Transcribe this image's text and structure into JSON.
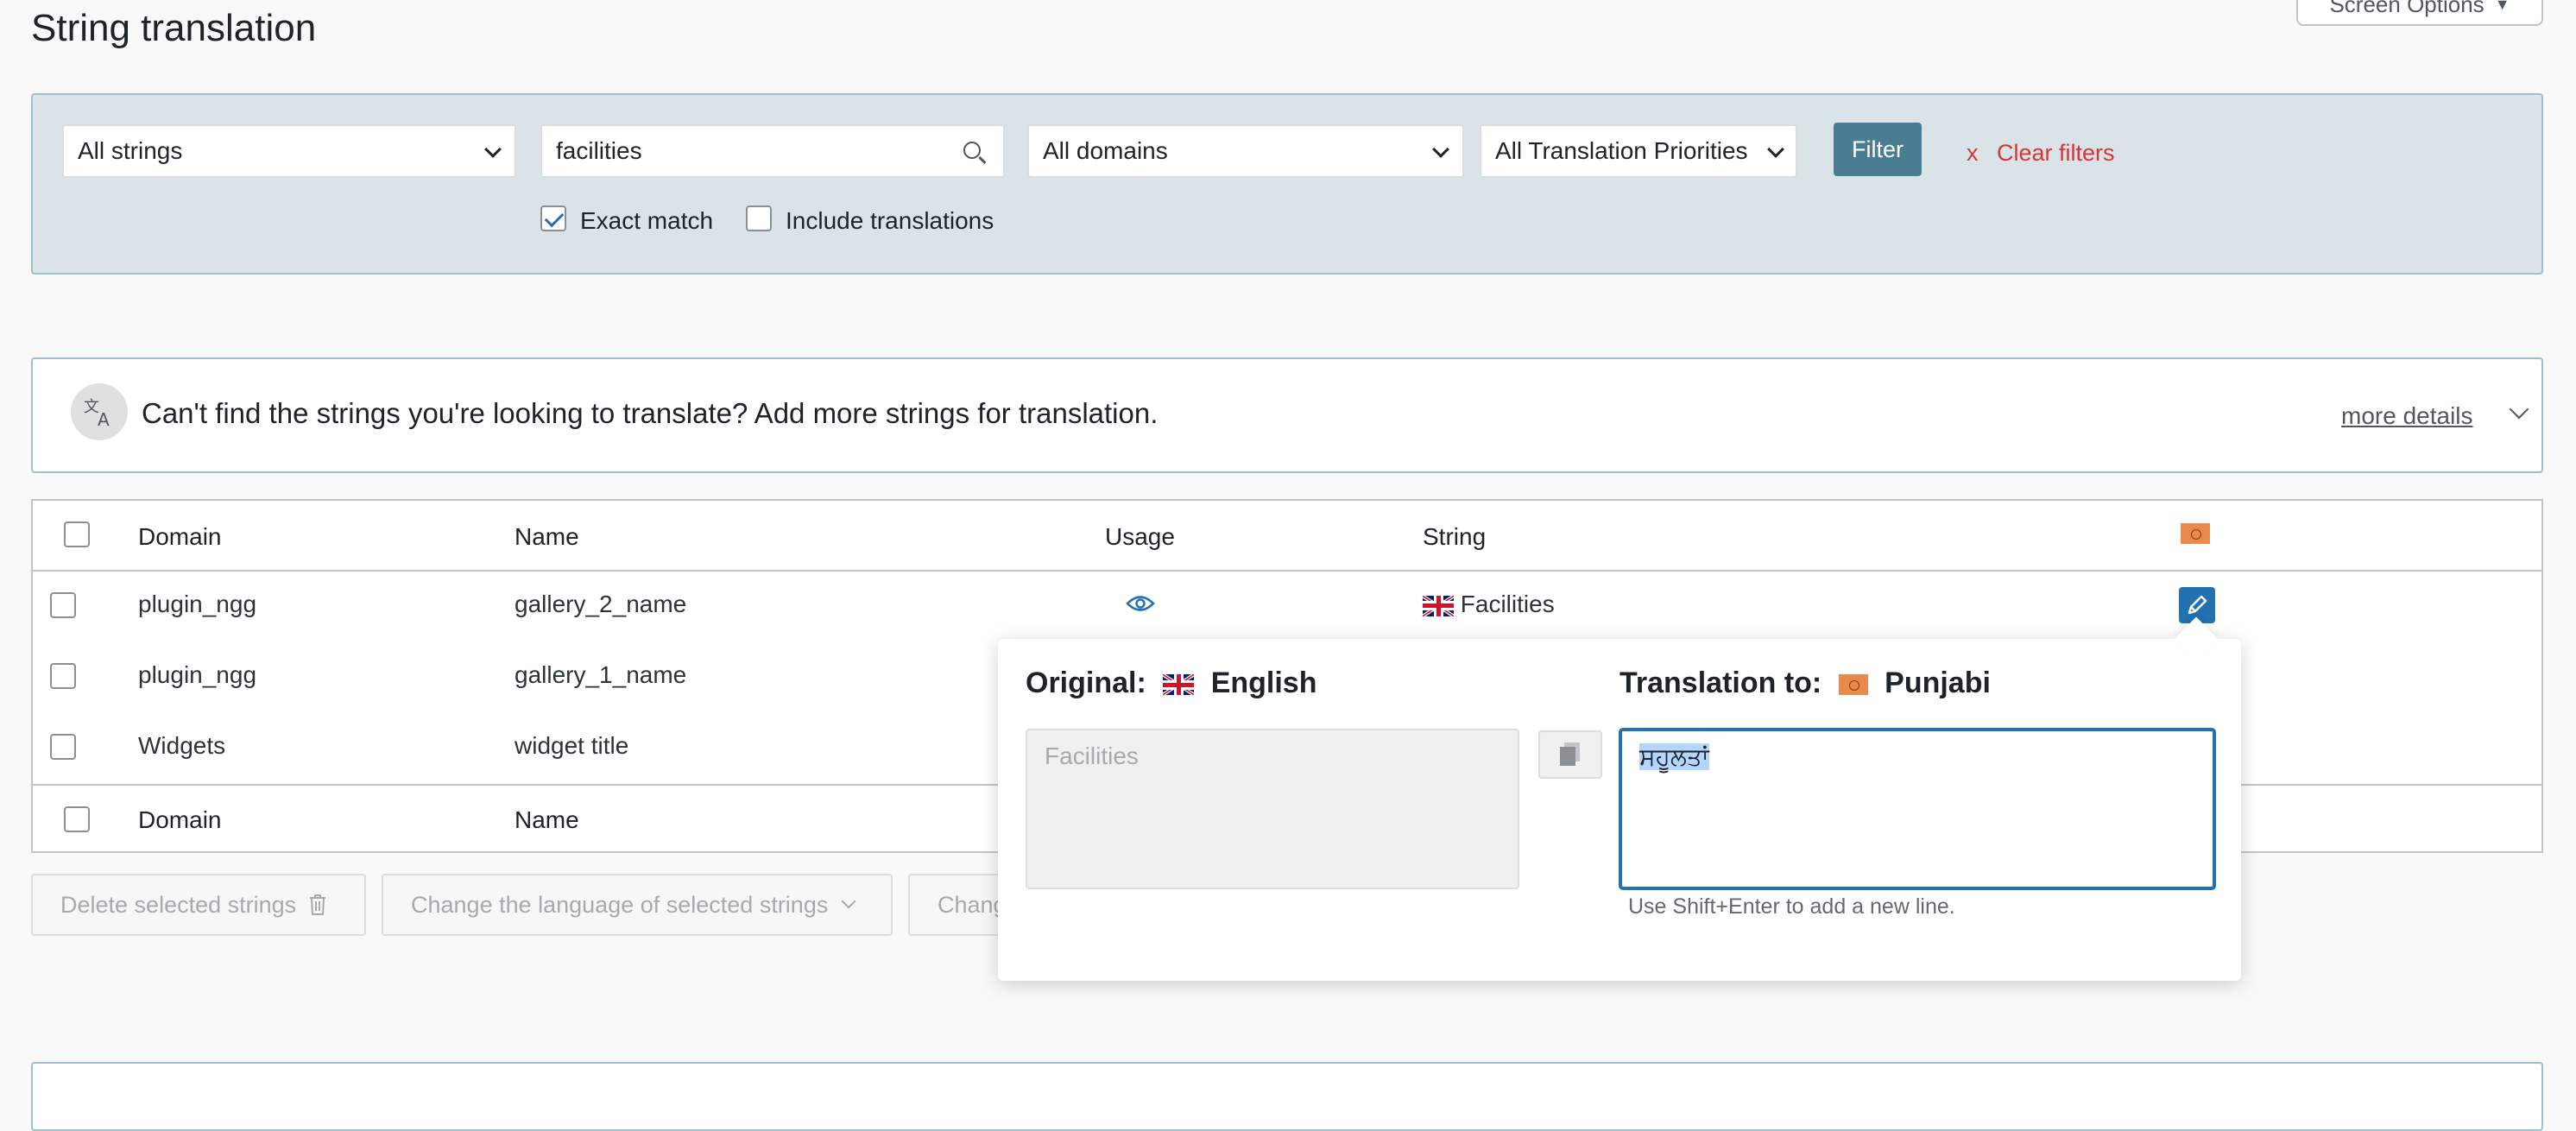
{
  "page": {
    "title": "String translation",
    "screen_options": "Screen Options"
  },
  "filters": {
    "strings_select": "All strings",
    "search_value": "facilities",
    "domains_select": "All domains",
    "priorities_select": "All Translation Priorities",
    "filter_button": "Filter",
    "clear_filters": "Clear filters",
    "clear_x": "x",
    "exact_match": "Exact match",
    "include_translations": "Include translations"
  },
  "notice": {
    "text": "Can't find the strings you're looking to translate? Add more strings for translation.",
    "more_details": "more details"
  },
  "table": {
    "headers": {
      "domain": "Domain",
      "name": "Name",
      "usage": "Usage",
      "string": "String"
    },
    "rows": [
      {
        "domain": "plugin_ngg",
        "name": "gallery_2_name",
        "string": "Facilities"
      },
      {
        "domain": "plugin_ngg",
        "name": "gallery_1_name"
      },
      {
        "domain": "Widgets",
        "name": "widget title"
      }
    ],
    "footer": {
      "domain": "Domain",
      "name": "Name"
    }
  },
  "bulk_actions": {
    "delete": "Delete selected strings",
    "change_language": "Change the language of selected strings",
    "change_other": "Chang"
  },
  "popup": {
    "original_label": "Original:",
    "original_language": "English",
    "translation_label": "Translation to:",
    "translation_language": "Punjabi",
    "original_text": "Facilities",
    "translation_text": "ਸਹੂਲਤਾਂ",
    "hint": "Use Shift+Enter to add a new line."
  },
  "colors": {
    "accent": "#2271b1",
    "filter_bg": "#d9e3e8",
    "clear": "#d63638",
    "filter_btn": "#4a7d91"
  }
}
